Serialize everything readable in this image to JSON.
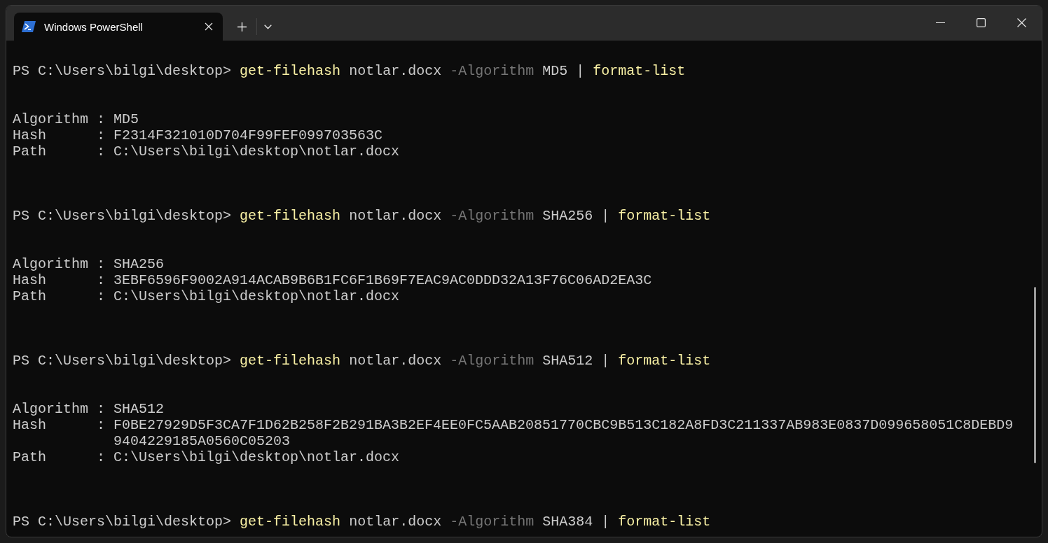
{
  "window": {
    "tabs": [
      {
        "title": "Windows PowerShell",
        "selected": true
      }
    ]
  },
  "terminal": {
    "blocks": [
      {
        "prompt": "PS C:\\Users\\bilgi\\desktop>",
        "command": [
          {
            "kind": "cmdlet",
            "text": "get-filehash"
          },
          {
            "kind": "argument",
            "text": "notlar.docx"
          },
          {
            "kind": "parameter",
            "text": "-Algorithm"
          },
          {
            "kind": "argument",
            "text": "MD5"
          },
          {
            "kind": "operator",
            "text": "|"
          },
          {
            "kind": "cmdlet",
            "text": "format-list"
          }
        ],
        "output": [
          {
            "name": "Algorithm",
            "separator": ":",
            "value": "MD5"
          },
          {
            "name": "Hash",
            "separator": ":",
            "value": "F2314F321010D704F99FEF099703563C"
          },
          {
            "name": "Path",
            "separator": ":",
            "value": "C:\\Users\\bilgi\\desktop\\notlar.docx"
          }
        ]
      },
      {
        "prompt": "PS C:\\Users\\bilgi\\desktop>",
        "command": [
          {
            "kind": "cmdlet",
            "text": "get-filehash"
          },
          {
            "kind": "argument",
            "text": "notlar.docx"
          },
          {
            "kind": "parameter",
            "text": "-Algorithm"
          },
          {
            "kind": "argument",
            "text": "SHA256"
          },
          {
            "kind": "operator",
            "text": "|"
          },
          {
            "kind": "cmdlet",
            "text": "format-list"
          }
        ],
        "output": [
          {
            "name": "Algorithm",
            "separator": ":",
            "value": "SHA256"
          },
          {
            "name": "Hash",
            "separator": ":",
            "value": "3EBF6596F9002A914ACAB9B6B1FC6F1B69F7EAC9AC0DDD32A13F76C06AD2EA3C"
          },
          {
            "name": "Path",
            "separator": ":",
            "value": "C:\\Users\\bilgi\\desktop\\notlar.docx"
          }
        ]
      },
      {
        "prompt": "PS C:\\Users\\bilgi\\desktop>",
        "command": [
          {
            "kind": "cmdlet",
            "text": "get-filehash"
          },
          {
            "kind": "argument",
            "text": "notlar.docx"
          },
          {
            "kind": "parameter",
            "text": "-Algorithm"
          },
          {
            "kind": "argument",
            "text": "SHA512"
          },
          {
            "kind": "operator",
            "text": "|"
          },
          {
            "kind": "cmdlet",
            "text": "format-list"
          }
        ],
        "output": [
          {
            "name": "Algorithm",
            "separator": ":",
            "value": "SHA512"
          },
          {
            "name": "Hash",
            "separator": ":",
            "value": "F0BE27929D5F3CA7F1D62B258F2B291BA3B2EF4EE0FC5AAB20851770CBC9B513C182A8FD3C211337AB983E0837D099658051C8DEBD99404229185A0560C05203"
          },
          {
            "name": "Path",
            "separator": ":",
            "value": "C:\\Users\\bilgi\\desktop\\notlar.docx"
          }
        ]
      },
      {
        "prompt": "PS C:\\Users\\bilgi\\desktop>",
        "command": [
          {
            "kind": "cmdlet",
            "text": "get-filehash"
          },
          {
            "kind": "argument",
            "text": "notlar.docx"
          },
          {
            "kind": "parameter",
            "text": "-Algorithm"
          },
          {
            "kind": "argument",
            "text": "SHA384"
          },
          {
            "kind": "operator",
            "text": "|"
          },
          {
            "kind": "cmdlet",
            "text": "format-list"
          }
        ]
      }
    ]
  }
}
